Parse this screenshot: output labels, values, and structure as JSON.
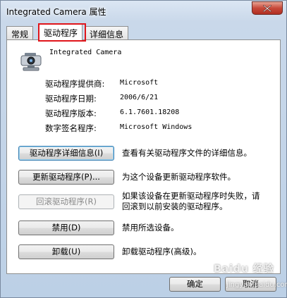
{
  "window": {
    "title": "Integrated Camera 属性"
  },
  "tabs": [
    {
      "label": "常规"
    },
    {
      "label": "驱动程序",
      "active": true
    },
    {
      "label": "详细信息"
    }
  ],
  "device": {
    "name": "Integrated Camera",
    "icon": "webcam-icon"
  },
  "info": [
    {
      "label": "驱动程序提供商:",
      "value": "Microsoft"
    },
    {
      "label": "驱动程序日期:",
      "value": "2006/6/21"
    },
    {
      "label": "驱动程序版本:",
      "value": "6.1.7601.18208"
    },
    {
      "label": "数字签名程序:",
      "value": "Microsoft Windows"
    }
  ],
  "actions": [
    {
      "button": "驱动程序详细信息(I)",
      "desc": "查看有关驱动程序文件的详细信息。"
    },
    {
      "button": "更新驱动程序(P)...",
      "desc": "为这个设备更新驱动程序软件。"
    },
    {
      "button": "回滚驱动程序(R)",
      "desc_line1": "如果该设备在更新驱动程序时失败，请",
      "desc_line2": "回滚到以前安装的驱动程序。",
      "disabled": true
    },
    {
      "button": "禁用(D)",
      "desc": "禁用所选设备。"
    },
    {
      "button": "卸载(U)",
      "desc": "卸载驱动程序(高级)。"
    }
  ],
  "footer": {
    "ok": "确定",
    "cancel": "取消"
  },
  "highlight_color": "#e0151b",
  "watermark": {
    "line1": "Baidu 经验",
    "line2": "jingyan.baidu.com"
  }
}
